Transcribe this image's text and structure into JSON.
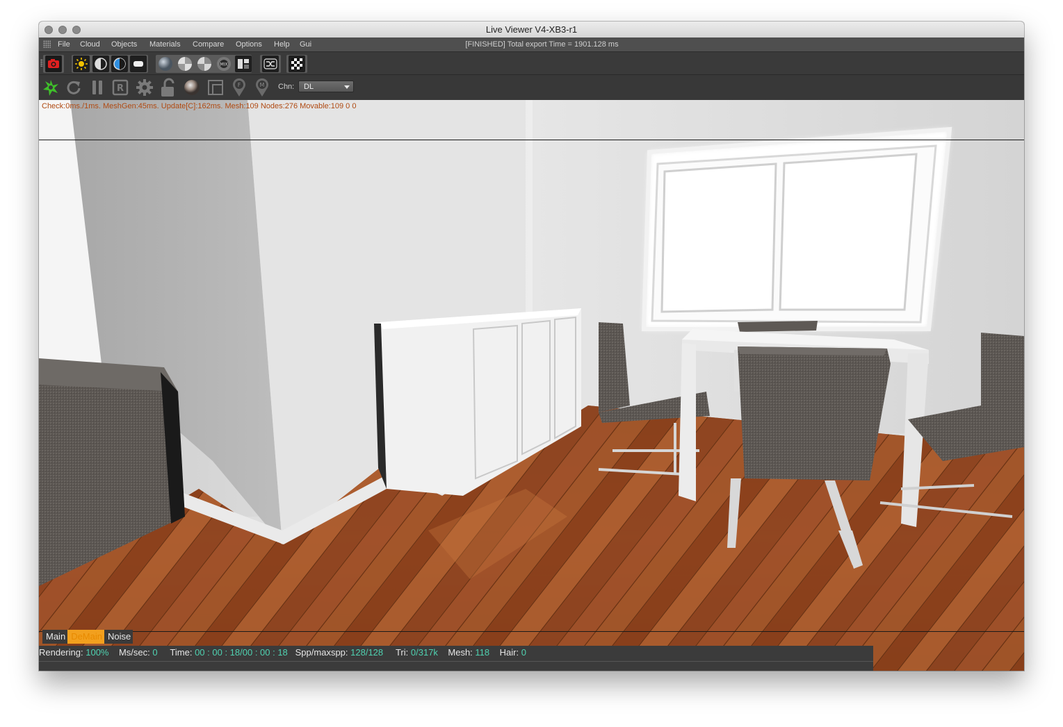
{
  "window": {
    "title": "Live Viewer V4-XB3-r1"
  },
  "menu": {
    "items": [
      "File",
      "Cloud",
      "Objects",
      "Materials",
      "Compare",
      "Options",
      "Help",
      "Gui"
    ],
    "export_status": "[FINISHED] Total export Time = 1901.128 ms"
  },
  "toolbar2": {
    "chn_label": "Chn:",
    "chn_value": "DL"
  },
  "viewport": {
    "stats": "Check:0ms./1ms. MeshGen:45ms. Update[C]:162ms. Mesh:109 Nodes:276 Movable:109  0 0"
  },
  "tabs": [
    "Main",
    "DeMain",
    "Noise"
  ],
  "active_tab": "DeMain",
  "status": {
    "rendering_label": "Rendering:",
    "rendering_value": "100%",
    "ms_label": "Ms/sec:",
    "ms_value": "0",
    "time_label": "Time:",
    "time_value": "00 : 00 : 18/00 : 00 : 18",
    "spp_label": "Spp/maxspp:",
    "spp_value": "128/128",
    "tri_label": "Tri:",
    "tri_value": "0/317k",
    "mesh_label": "Mesh:",
    "mesh_value": "118",
    "hair_label": "Hair:",
    "hair_value": "0"
  },
  "icons": {
    "toolbar1": [
      "camera-capture-icon",
      "sun-icon",
      "contrast-icon",
      "contrast-alt-icon",
      "display-icon",
      "sphere-icon",
      "sphere-checker-icon",
      "sphere-checker-alt-icon",
      "sphere-mix-icon",
      "split-view-icon",
      "shuffle-icon",
      "checkerboard-icon"
    ],
    "toolbar2": [
      "octane-logo-icon",
      "restart-icon",
      "pause-icon",
      "render-region-icon",
      "settings-gear-icon",
      "lock-icon",
      "material-sphere-icon",
      "region-select-icon",
      "focus-pin-icon",
      "material-pin-icon"
    ]
  },
  "colors": {
    "accent_tab": "#f2a01e",
    "status_value": "#4fd1b0",
    "stats_text": "#b04a12",
    "octane_green": "#3fbf2a",
    "capture_red": "#e02020"
  }
}
